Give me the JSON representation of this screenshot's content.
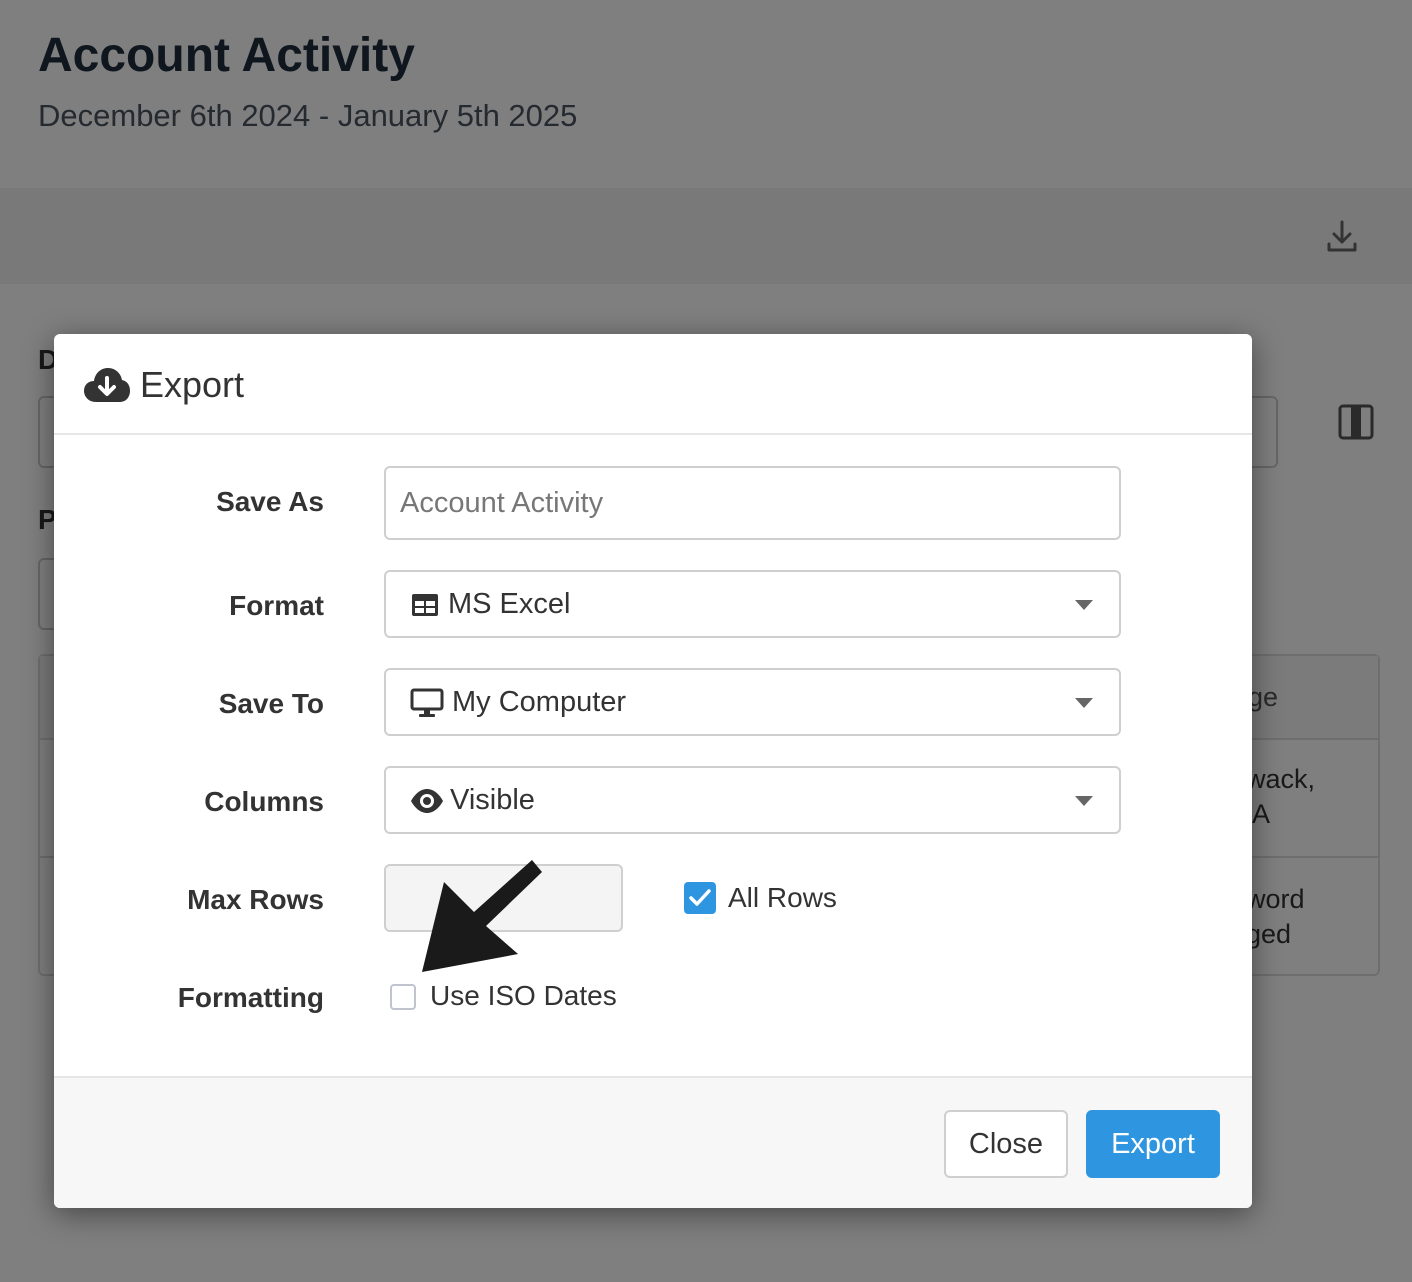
{
  "page": {
    "title": "Account Activity",
    "subtitle": "December 6th 2024 - January 5th 2025",
    "partial_label_1": "D",
    "partial_label_2": "P",
    "table": {
      "header_fragment": "ge",
      "row1_fragment": "wack,\n A",
      "row2_fragment": "word\nged"
    }
  },
  "modal": {
    "title": "Export",
    "fields": {
      "save_as": {
        "label": "Save As",
        "placeholder": "Account Activity"
      },
      "format": {
        "label": "Format",
        "value": "MS Excel",
        "icon": "table-icon"
      },
      "save_to": {
        "label": "Save To",
        "value": "My Computer",
        "icon": "desktop-icon"
      },
      "columns": {
        "label": "Columns",
        "value": "Visible",
        "icon": "eye-icon"
      },
      "max_rows": {
        "label": "Max Rows",
        "value": ""
      },
      "all_rows": {
        "label": "All Rows",
        "checked": true
      },
      "formatting": {
        "label": "Formatting"
      },
      "iso_dates": {
        "label": "Use ISO Dates",
        "checked": false
      }
    },
    "buttons": {
      "close": "Close",
      "export": "Export"
    }
  },
  "colors": {
    "primary": "#2e96e0",
    "overlay": "rgba(0,0,0,0.5)"
  }
}
